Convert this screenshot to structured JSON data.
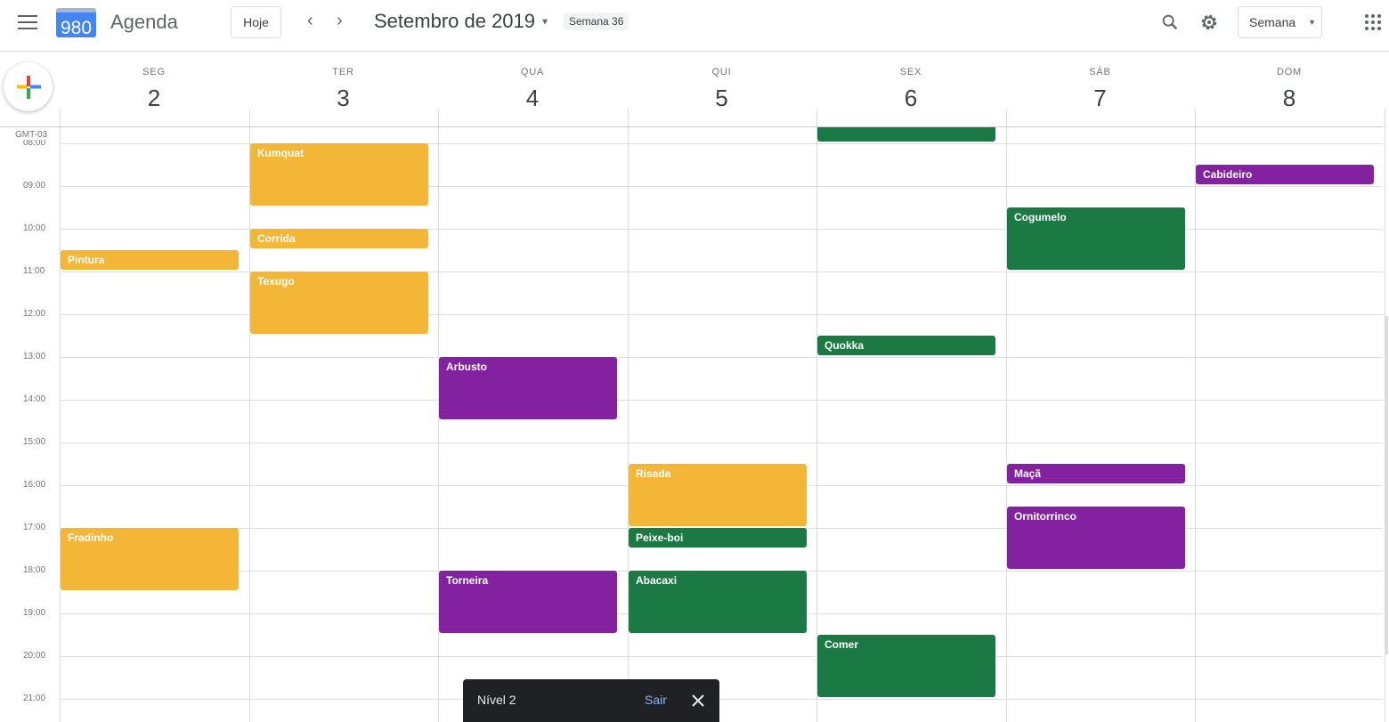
{
  "header": {
    "logo_text": "980",
    "app_name": "Agenda",
    "today_label": "Hoje",
    "prev_icon": "chevron-left",
    "next_icon": "chevron-right",
    "title": "Setembro de 2019",
    "week_badge": "Semana 36",
    "view_label": "Semana"
  },
  "colors": {
    "yellow": "#F4B637",
    "green": "#1B7A43",
    "purple": "#8421A0"
  },
  "timezone": "GMT-03",
  "days": [
    {
      "name": "SEG",
      "num": "2"
    },
    {
      "name": "TER",
      "num": "3"
    },
    {
      "name": "QUA",
      "num": "4"
    },
    {
      "name": "QUI",
      "num": "5"
    },
    {
      "name": "SEX",
      "num": "6"
    },
    {
      "name": "SÁB",
      "num": "7"
    },
    {
      "name": "DOM",
      "num": "8"
    }
  ],
  "hours": [
    "08:00",
    "09:00",
    "10:00",
    "11:00",
    "12:00",
    "13:00",
    "14:00",
    "15:00",
    "16:00",
    "17:00",
    "18:00",
    "19:00",
    "20:00",
    "21:00"
  ],
  "events": [
    {
      "title": "Pintura",
      "day": 0,
      "start": 10.5,
      "end": 11,
      "color": "yellow"
    },
    {
      "title": "Fradinho",
      "day": 0,
      "start": 17,
      "end": 18.5,
      "color": "yellow"
    },
    {
      "title": "Kumquat",
      "day": 1,
      "start": 8,
      "end": 9.5,
      "color": "yellow"
    },
    {
      "title": "Corrida",
      "day": 1,
      "start": 10,
      "end": 10.5,
      "color": "yellow"
    },
    {
      "title": "Texugo",
      "day": 1,
      "start": 11,
      "end": 12.5,
      "color": "yellow"
    },
    {
      "title": "Arbusto",
      "day": 2,
      "start": 13,
      "end": 14.5,
      "color": "purple"
    },
    {
      "title": "Torneira",
      "day": 2,
      "start": 18,
      "end": 19.5,
      "color": "purple"
    },
    {
      "title": "Risada",
      "day": 3,
      "start": 15.5,
      "end": 17,
      "color": "yellow"
    },
    {
      "title": "Peixe-boi",
      "day": 3,
      "start": 17,
      "end": 17.5,
      "color": "green"
    },
    {
      "title": "Abacaxi",
      "day": 3,
      "start": 18,
      "end": 19.5,
      "color": "green"
    },
    {
      "title": "",
      "day": 4,
      "start": 7,
      "end": 8,
      "color": "green"
    },
    {
      "title": "Quokka",
      "day": 4,
      "start": 12.5,
      "end": 13,
      "color": "green"
    },
    {
      "title": "Comer",
      "day": 4,
      "start": 19.5,
      "end": 21,
      "color": "green"
    },
    {
      "title": "Cogumelo",
      "day": 5,
      "start": 9.5,
      "end": 11,
      "color": "green"
    },
    {
      "title": "Maçã",
      "day": 5,
      "start": 15.5,
      "end": 16,
      "color": "purple"
    },
    {
      "title": "Ornitorrinco",
      "day": 5,
      "start": 16.5,
      "end": 18,
      "color": "purple"
    },
    {
      "title": "Cabideiro",
      "day": 6,
      "start": 8.5,
      "end": 9,
      "color": "purple"
    }
  ],
  "snackbar": {
    "text": "Nível 2",
    "action": "Sair"
  }
}
